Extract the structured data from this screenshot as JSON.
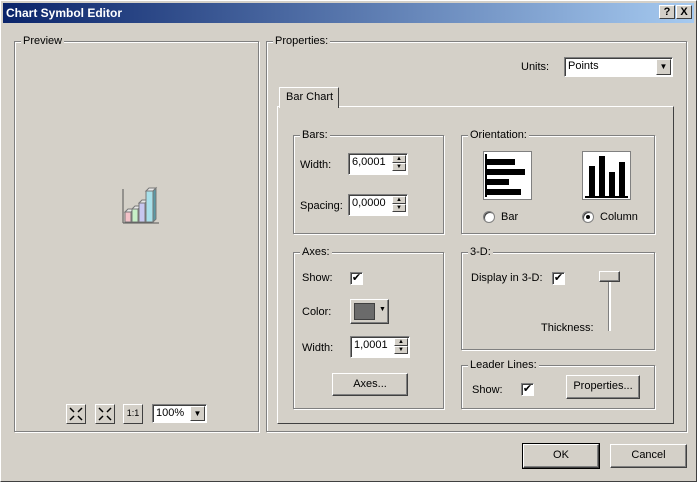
{
  "window": {
    "title": "Chart Symbol Editor",
    "help_label": "?",
    "close_label": "X"
  },
  "preview": {
    "group_label": "Preview",
    "zoom_value": "100%",
    "tools": {
      "fit_label": "1:1"
    }
  },
  "properties": {
    "group_label": "Properties:",
    "units_label": "Units:",
    "units_value": "Points",
    "tab_label": "Bar Chart",
    "bars": {
      "group_label": "Bars:",
      "width_label": "Width:",
      "width_value": "6,0001",
      "spacing_label": "Spacing:",
      "spacing_value": "0,0000"
    },
    "orientation": {
      "group_label": "Orientation:",
      "bar_label": "Bar",
      "column_label": "Column",
      "selected": "column"
    },
    "axes": {
      "group_label": "Axes:",
      "show_label": "Show:",
      "show_checked": true,
      "color_label": "Color:",
      "color_value": "#6b6b6b",
      "width_label": "Width:",
      "width_value": "1,0001",
      "axes_button": "Axes..."
    },
    "three_d": {
      "group_label": "3-D:",
      "display_label": "Display in 3-D:",
      "display_checked": true,
      "thickness_label": "Thickness:"
    },
    "leader_lines": {
      "group_label": "Leader Lines:",
      "show_label": "Show:",
      "show_checked": true,
      "properties_button": "Properties..."
    }
  },
  "buttons": {
    "ok": "OK",
    "cancel": "Cancel"
  },
  "icons": {
    "check": "✔",
    "spin_up": "▲",
    "spin_down": "▼",
    "dropdown": "▼"
  }
}
